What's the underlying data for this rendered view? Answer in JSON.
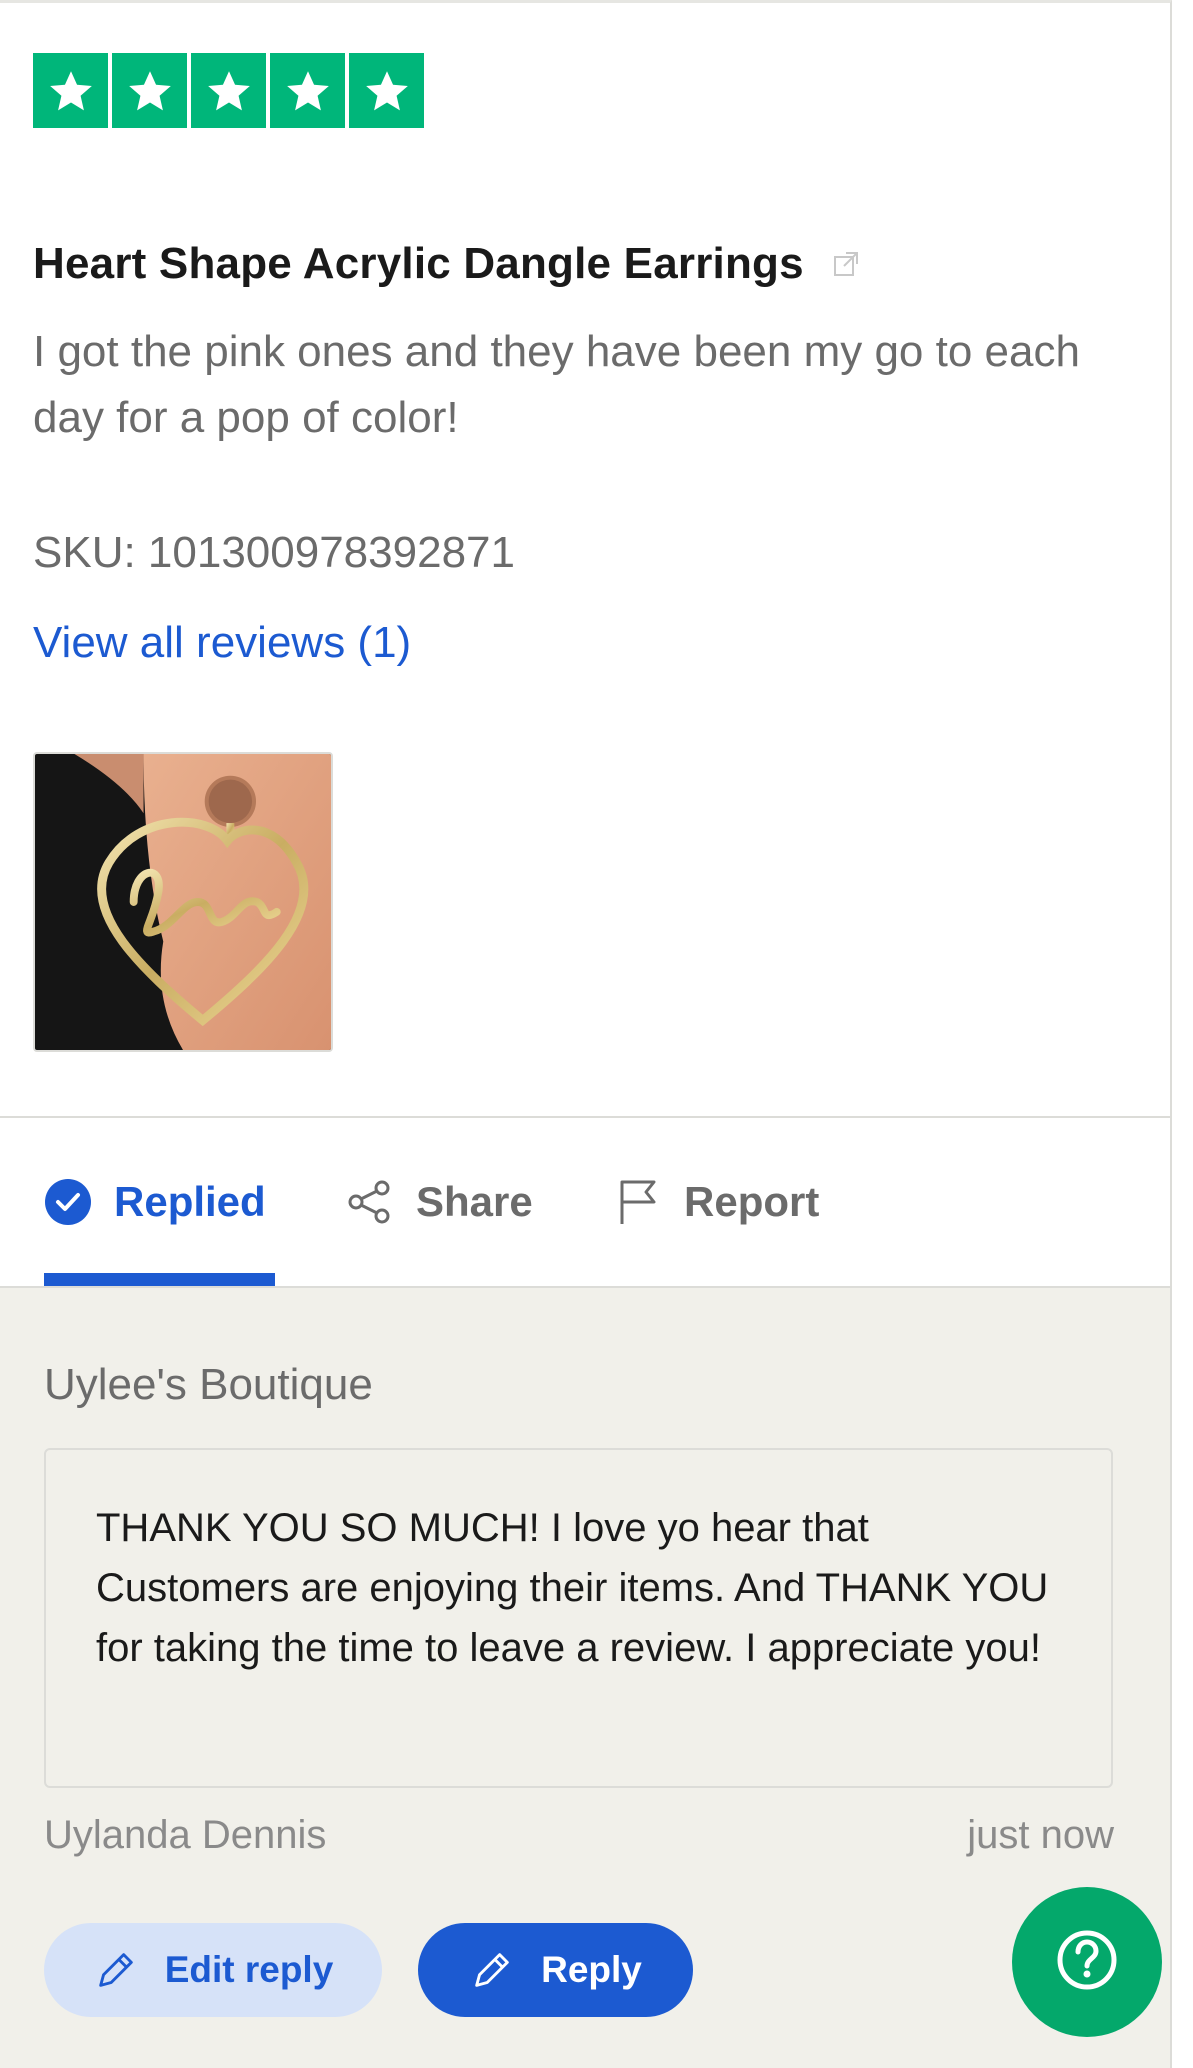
{
  "rating": {
    "stars": 5,
    "max": 5,
    "color": "#00b67a",
    "icon": "star-icon"
  },
  "review": {
    "title": "Heart Shape Acrylic Dangle Earrings",
    "body": "I got the pink ones and they have been my go to each day for a pop of color!",
    "sku": "SKU: 101300978392871",
    "view_all": "View all reviews (1)",
    "photo_icon": "earring-photo"
  },
  "actions": {
    "replied": "Replied",
    "share": "Share",
    "report": "Report"
  },
  "reply": {
    "shop_name": "Uylee's Boutique",
    "text": "THANK YOU SO MUCH! I love yo hear that Customers are enjoying their items. And THANK YOU for taking the time to leave a review. I appreciate you!",
    "author": "Uylanda Dennis",
    "timestamp": "just now",
    "edit_label": "Edit reply",
    "reply_label": "Reply"
  },
  "colors": {
    "accent": "#1c5ad1",
    "trustpilot_green": "#00b67a",
    "help_green": "#04a86b",
    "reply_bg": "#f1f0ea"
  }
}
